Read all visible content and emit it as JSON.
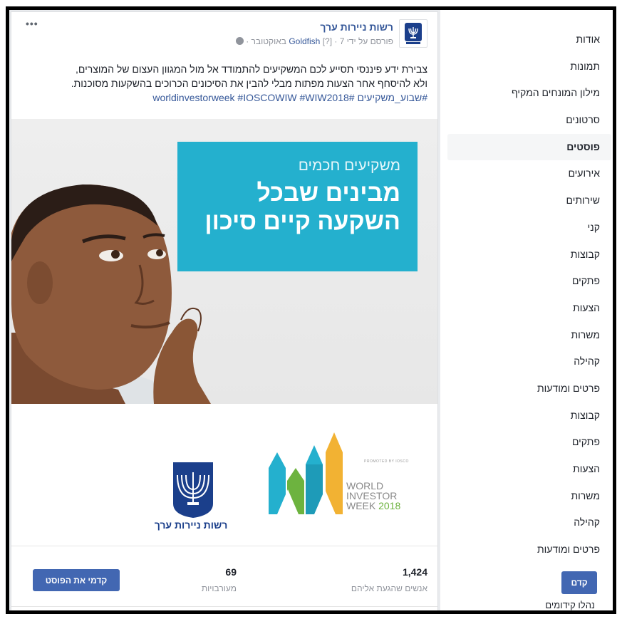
{
  "sidebar": {
    "items": [
      {
        "label": "אודות",
        "active": false
      },
      {
        "label": "תמונות",
        "active": false
      },
      {
        "label": "מילון המונחים המקיף",
        "active": false
      },
      {
        "label": "סרטונים",
        "active": false
      },
      {
        "label": "פוסטים",
        "active": true
      },
      {
        "label": "אירועים",
        "active": false
      },
      {
        "label": "שירותים",
        "active": false
      },
      {
        "label": "קני",
        "active": false
      },
      {
        "label": "קבוצות",
        "active": false
      },
      {
        "label": "פתקים",
        "active": false
      },
      {
        "label": "הצעות",
        "active": false
      },
      {
        "label": "משרות",
        "active": false
      },
      {
        "label": "קהילה",
        "active": false
      },
      {
        "label": "פרטים ומודעות",
        "active": false
      },
      {
        "label": "קבוצות",
        "active": false
      },
      {
        "label": "פתקים",
        "active": false
      },
      {
        "label": "הצעות",
        "active": false
      },
      {
        "label": "משרות",
        "active": false
      },
      {
        "label": "קהילה",
        "active": false
      },
      {
        "label": "פרטים ומודעות",
        "active": false
      }
    ],
    "promote_label": "קדם",
    "clipped_text": "נהלו קידומים"
  },
  "post": {
    "page_name": "רשות ניירות ערך",
    "meta_prefix": "פורסם על ידי",
    "author": "Goldfish",
    "meta_suffix": "[?] · 7 באוקטובר ·",
    "text_line1": "צבירת ידע פיננסי תסייע לכם המשקיעים להתמודד אל מול המגוון העצום של המוצרים,",
    "text_line2": "ולא להיסחף אחר הצעות מפתות מבלי להבין את הסיכונים הכרוכים בהשקעות מסוכנות.",
    "hashtags": "#שבוע_משקיעים #worldinvestorweek #IOSCOWIW #WIW2018",
    "more_label": "•••"
  },
  "image": {
    "subtitle": "משקיעים חכמים",
    "headline_line1": "מבינים שבכל",
    "headline_line2": "השקעה קיים סיכון"
  },
  "logos": {
    "wiw_tag": "PROMOTED BY IOSCO",
    "wiw_line1": "WORLD",
    "wiw_line2": "INVESTOR",
    "wiw_line3": "WEEK",
    "wiw_year": "2018",
    "isa_name": "רשות ניירות ערך"
  },
  "insights": {
    "reached_count": "1,424",
    "reached_label": "אנשים שהגעת אליהם",
    "engagement_count": "69",
    "engagement_label": "מעורבויות",
    "boost_label": "קדמי את הפוסט"
  },
  "colors": {
    "brand_blue": "#4267b2",
    "link_blue": "#365899",
    "teal": "#24b0ce",
    "wiw_green": "#6db33f",
    "wiw_yellow": "#f2b233",
    "isa_navy": "#1b3f8b"
  }
}
